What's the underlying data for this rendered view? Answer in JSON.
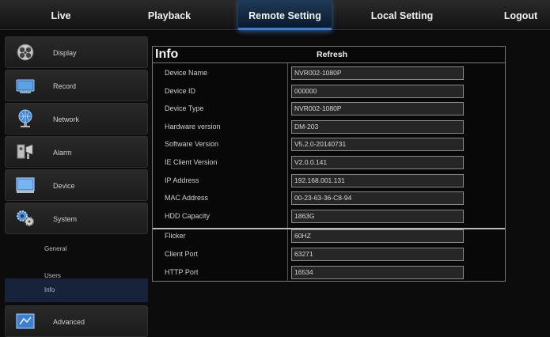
{
  "nav": {
    "tabs": [
      {
        "label": "Live"
      },
      {
        "label": "Playback"
      },
      {
        "label": "Remote Setting"
      },
      {
        "label": "Local Setting"
      },
      {
        "label": "Logout"
      }
    ],
    "active_tab": "Remote Setting"
  },
  "sidebar": {
    "items": [
      {
        "label": "Display",
        "icon": "display-icon"
      },
      {
        "label": "Record",
        "icon": "record-icon"
      },
      {
        "label": "Network",
        "icon": "network-icon"
      },
      {
        "label": "Alarm",
        "icon": "alarm-icon"
      },
      {
        "label": "Device",
        "icon": "device-icon"
      },
      {
        "label": "System",
        "icon": "system-icon"
      }
    ],
    "sub_items": [
      {
        "label": "General"
      },
      {
        "label": "Users"
      },
      {
        "label": "Info"
      }
    ],
    "last_item": {
      "label": "Advanced",
      "icon": "advanced-icon"
    },
    "active_sub": "Info"
  },
  "panel": {
    "title": "Info",
    "refresh_label": "Refresh",
    "rows": [
      {
        "key": "Device Name",
        "value": "NVR002-1080P"
      },
      {
        "key": "Device ID",
        "value": "000000"
      },
      {
        "key": "Device Type",
        "value": "NVR002-1080P"
      },
      {
        "key": "Hardware version",
        "value": "DM-203"
      },
      {
        "key": "Software Version",
        "value": "V5.2.0-20140731"
      },
      {
        "key": "IE Client Version",
        "value": "V2.0.0.141"
      },
      {
        "key": "IP Address",
        "value": "192.168.001.131"
      },
      {
        "key": "MAC Address",
        "value": "00-23-63-36-C8-94"
      },
      {
        "key": "HDD Capacity",
        "value": "1863G"
      },
      {
        "key": "Flicker",
        "value": "60HZ"
      },
      {
        "key": "Client Port",
        "value": "63271"
      },
      {
        "key": "HTTP Port",
        "value": "16534"
      }
    ]
  },
  "colors": {
    "accent": "#3f7fd0",
    "background": "#0c0c0c",
    "field_bg": "#262626"
  }
}
